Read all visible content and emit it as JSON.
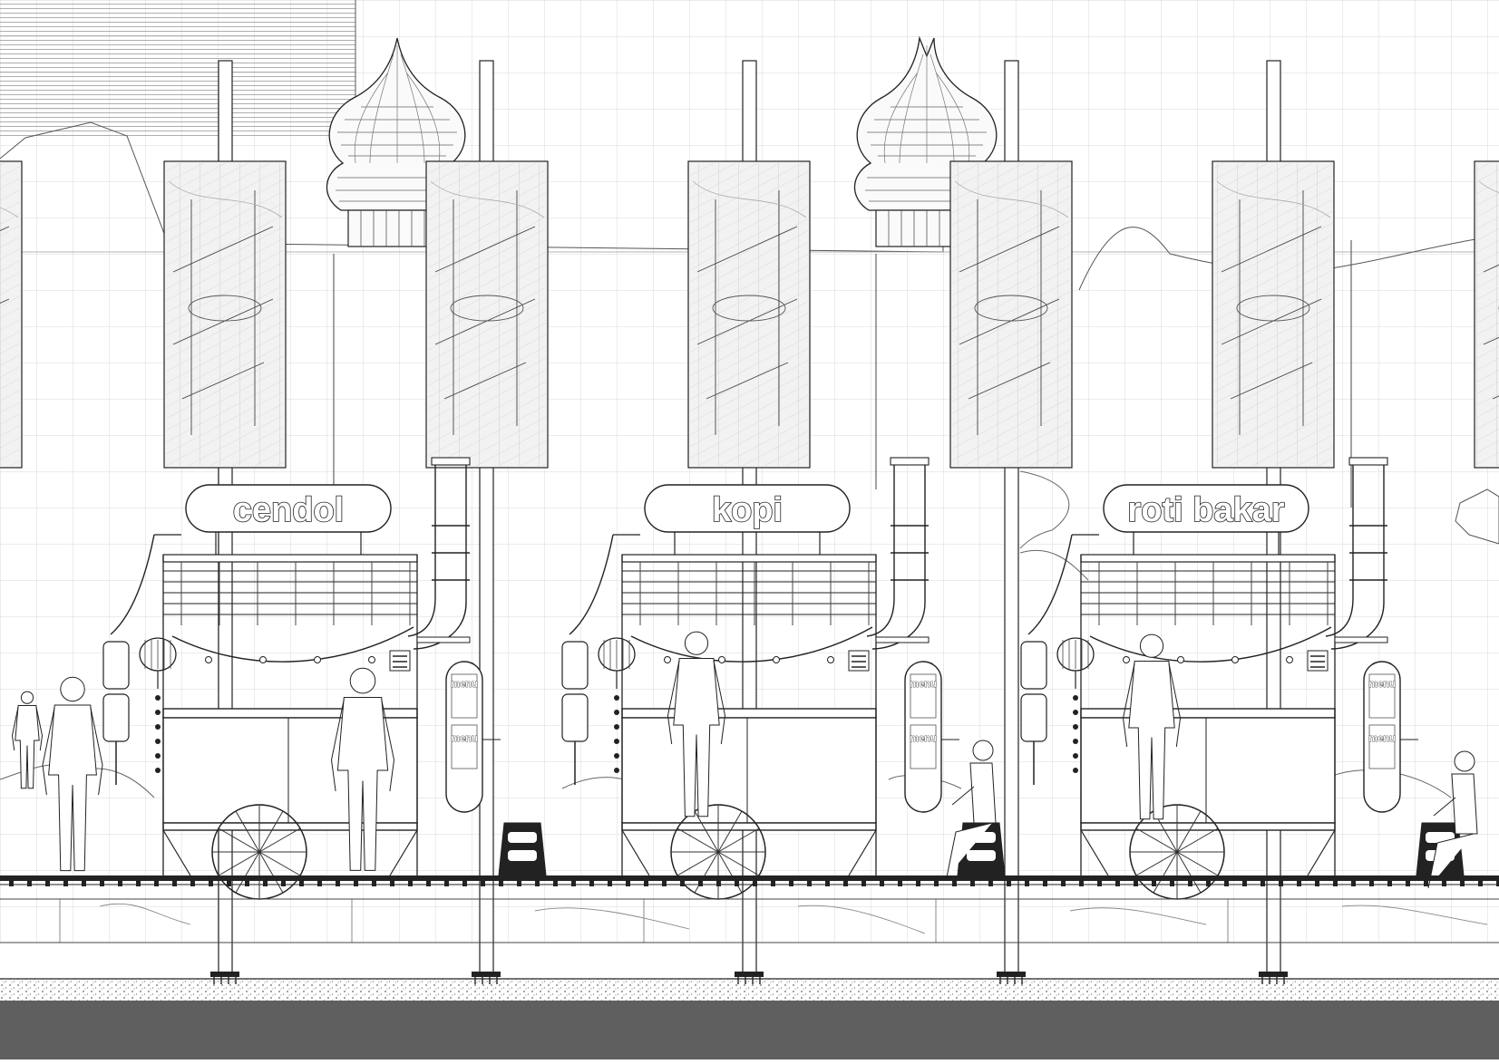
{
  "stalls": [
    {
      "name": "cendol",
      "menu_label": "menu"
    },
    {
      "name": "kopi",
      "menu_label": "menu"
    },
    {
      "name": "roti bakar",
      "menu_label": "menu"
    }
  ],
  "colors": {
    "line": "#222222",
    "grid": "#d9d9d9",
    "panel_fill": "#f2f2f2",
    "road": "#5f5f5f",
    "background": "#ffffff"
  }
}
